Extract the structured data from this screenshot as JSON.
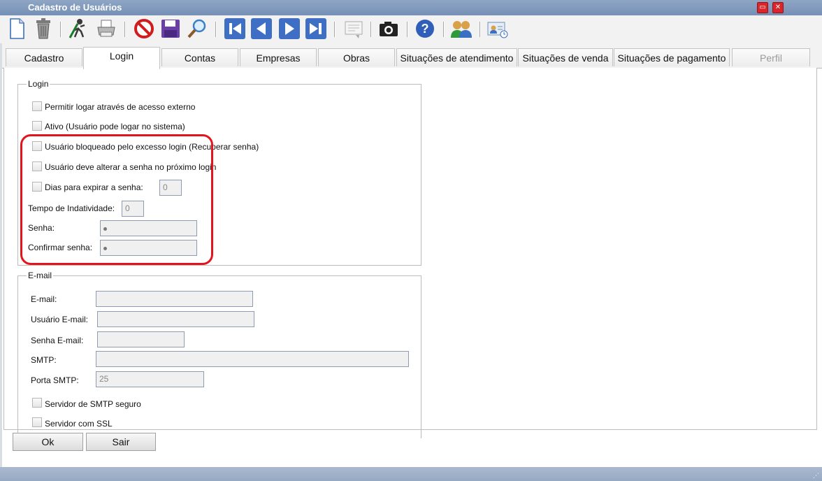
{
  "window": {
    "title": "Cadastro de Usuários",
    "restore_label": "▭",
    "close_label": "✕"
  },
  "toolbar": {
    "icons": [
      "new-document-icon",
      "trash-icon",
      "edit-person-icon",
      "printer-icon",
      "cancel-icon",
      "save-icon",
      "search-icon",
      "first-record-icon",
      "previous-record-icon",
      "next-record-icon",
      "last-record-icon",
      "notes-icon",
      "camera-icon",
      "help-icon",
      "users-group-icon",
      "user-card-icon"
    ]
  },
  "tabs": [
    {
      "label": "Cadastro"
    },
    {
      "label": "Login"
    },
    {
      "label": "Contas"
    },
    {
      "label": "Empresas"
    },
    {
      "label": "Obras"
    },
    {
      "label": "Situações de atendimento"
    },
    {
      "label": "Situações de venda"
    },
    {
      "label": "Situações de pagamento"
    },
    {
      "label": "Perfil"
    }
  ],
  "login": {
    "legend": "Login",
    "external_access": "Permitir logar através de acesso externo",
    "active": "Ativo (Usuário pode logar no sistema)",
    "blocked": "Usuário bloqueado pelo excesso login (Recuperar senha)",
    "must_change": "Usuário deve alterar a senha no próximo login",
    "expire_days_label": "Dias para expirar a senha:",
    "expire_days_value": "0",
    "idle_label": "Tempo de Indatividade:",
    "idle_value": "0",
    "password_label": "Senha:",
    "confirm_label": "Confirmar senha:"
  },
  "email": {
    "legend": "E-mail",
    "email_label": "E-mail:",
    "user_label": "Usuário E-mail:",
    "password_label": "Senha E-mail:",
    "smtp_label": "SMTP:",
    "port_label": "Porta SMTP:",
    "port_value": "25",
    "secure_smtp": "Servidor de SMTP seguro",
    "ssl": "Servidor com SSL"
  },
  "buttons": {
    "ok": "Ok",
    "exit": "Sair"
  },
  "colors": {
    "highlight": "#e3141c",
    "titlebar": "#7f98bb"
  }
}
